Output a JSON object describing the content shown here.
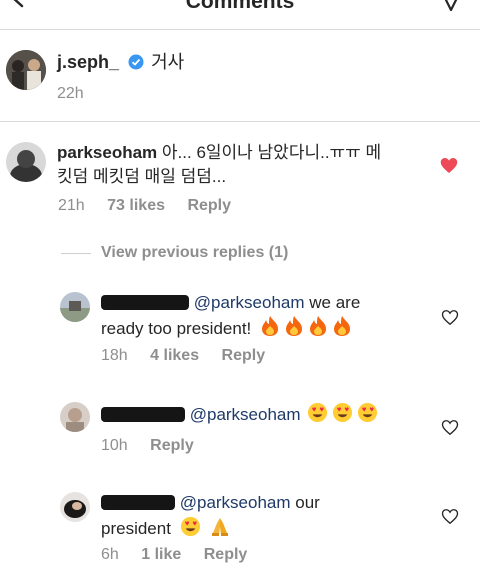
{
  "header": {
    "title": "Comments"
  },
  "caption": {
    "username": "j.seph_",
    "text": "거사",
    "time": "22h"
  },
  "top_comment": {
    "username": "parkseoham",
    "text_line1": "아... 6일이나 남았다니..ㅠㅠ 메",
    "text_line2": "킷덤 메킷덤 매일 덤덤...",
    "time": "21h",
    "likes": "73 likes",
    "reply": "Reply",
    "liked": true
  },
  "view_replies": "View previous replies (1)",
  "replies": [
    {
      "mention": "@parkseoham",
      "text_line1": " we are",
      "text_line2": "ready too president!",
      "emojis_count": 4,
      "time": "18h",
      "likes": "4 likes",
      "reply": "Reply"
    },
    {
      "mention": "@parkseoham",
      "text_line1": "",
      "emojis_count": 3,
      "time": "10h",
      "likes": "",
      "reply": "Reply"
    },
    {
      "mention": "@parkseoham",
      "text_line1": " our",
      "text_line2": "president",
      "time": "6h",
      "likes": "1 like",
      "reply": "Reply"
    }
  ],
  "colors": {
    "like_red": "#ed4956",
    "verified_blue": "#3897f0",
    "mention_blue": "#1f3a68",
    "muted": "#8e8e8e"
  },
  "icons": [
    "back-arrow-icon",
    "send-icon",
    "verified-badge-icon",
    "heart-filled-icon",
    "heart-outline-icon",
    "fire-emoji-icon",
    "heart-eyes-emoji-icon",
    "folded-hands-emoji-icon"
  ]
}
